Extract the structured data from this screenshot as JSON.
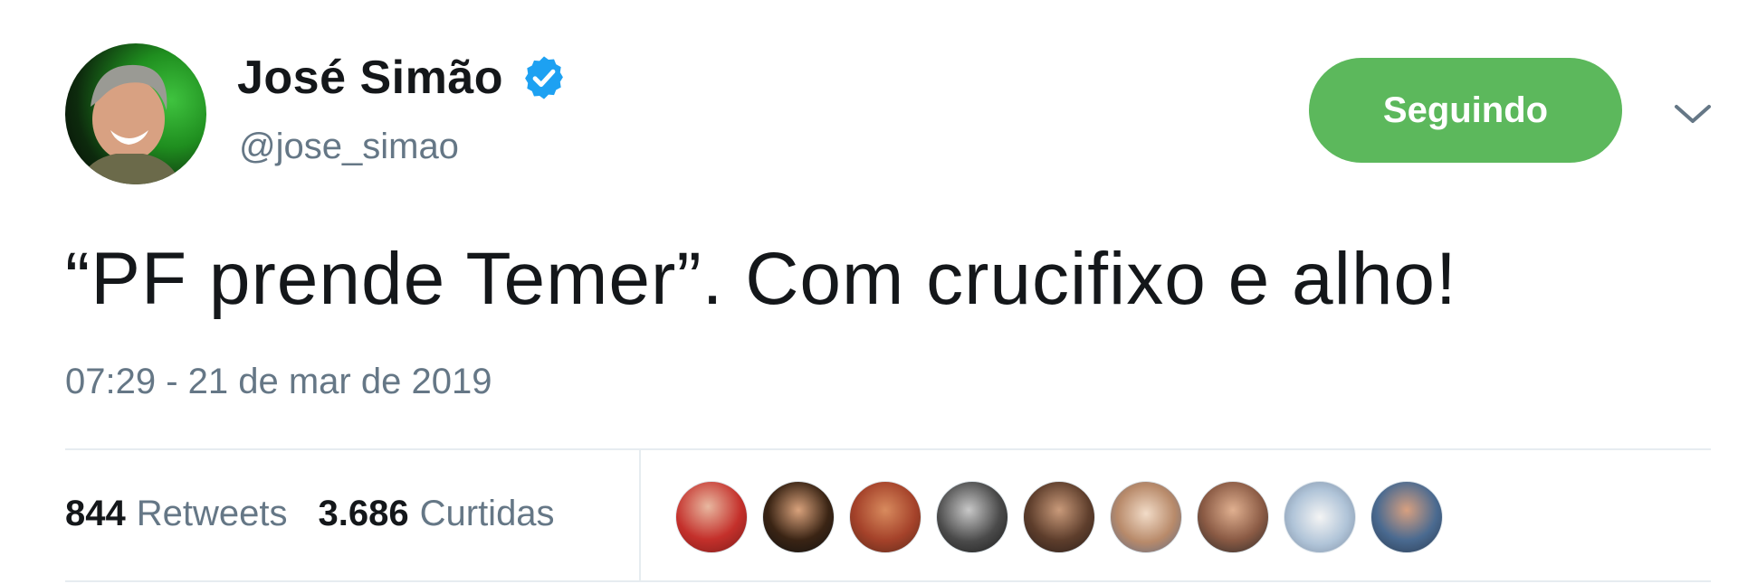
{
  "author": {
    "display_name": "José Simão",
    "handle": "@jose_simao",
    "verified": true
  },
  "follow_button": {
    "label": "Seguindo",
    "color": "#5cb85c"
  },
  "tweet": {
    "text": "“PF prende Temer”. Com crucifixo e alho!",
    "timestamp": "07:29 - 21 de mar de 2019"
  },
  "stats": {
    "retweets_count": "844",
    "retweets_label": "Retweets",
    "likes_count": "3.686",
    "likes_label": "Curtidas"
  },
  "icons": {
    "verified": "verified-badge-icon",
    "menu": "chevron-down-icon"
  },
  "colors": {
    "text_primary": "#14171a",
    "text_secondary": "#657786",
    "verified_blue": "#1da1f2",
    "divider": "#e6ecf0"
  },
  "likers_count_shown": 9
}
